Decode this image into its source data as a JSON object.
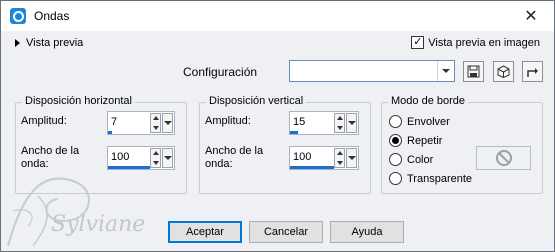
{
  "window": {
    "title": "Ondas",
    "close_glyph": "✕"
  },
  "preview": {
    "toggle_label": "Vista previa",
    "checkbox_label": "Vista previa en imagen",
    "checked": true
  },
  "config": {
    "label": "Configuración",
    "value": ""
  },
  "toolbar": {
    "save_icon": "save-icon",
    "randomize_icon": "dice-icon",
    "reset_icon": "reset-icon"
  },
  "horizontal": {
    "title": "Disposición horizontal",
    "amplitude_label": "Amplitud:",
    "amplitude": "7",
    "wavelength_label_1": "Ancho de la",
    "wavelength_label_2": "onda:",
    "wavelength": "100"
  },
  "vertical": {
    "title": "Disposición vertical",
    "amplitude_label": "Amplitud:",
    "amplitude": "15",
    "wavelength_label_1": "Ancho de la",
    "wavelength_label_2": "onda:",
    "wavelength": "100"
  },
  "edge_mode": {
    "title": "Modo de borde",
    "options": [
      "Envolver",
      "Repetir",
      "Color",
      "Transparente"
    ],
    "selected": "Repetir"
  },
  "buttons": {
    "ok": "Aceptar",
    "cancel": "Cancelar",
    "help": "Ayuda"
  },
  "watermark": {
    "text": "Sylviane"
  },
  "colors": {
    "accent": "#1c6fd0",
    "title_icon": "#1f86d6",
    "focus": "#0078d7"
  }
}
